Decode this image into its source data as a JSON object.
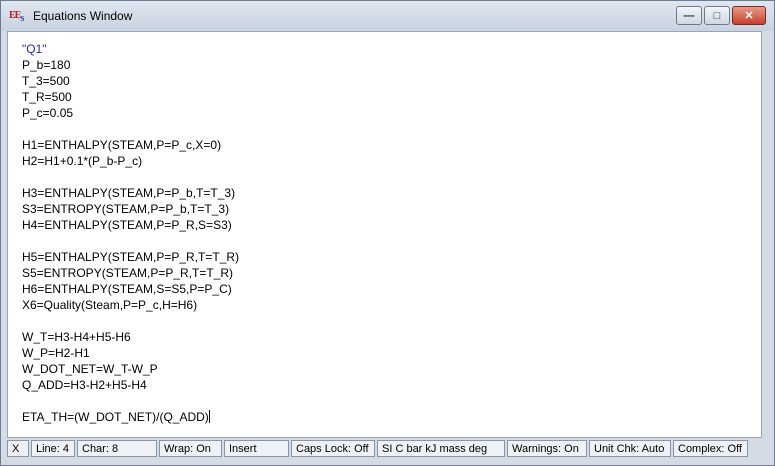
{
  "window": {
    "title": "Equations Window",
    "icon": "ees-app-icon",
    "icon_text": "EES"
  },
  "controls": {
    "minimize": "minimize-icon",
    "maximize": "maximize-icon",
    "close": "close-icon"
  },
  "editor": {
    "lines": [
      {
        "text": "\"Q1\"",
        "type": "comment"
      },
      {
        "text": "P_b=180",
        "type": "code"
      },
      {
        "text": "T_3=500",
        "type": "code"
      },
      {
        "text": "T_R=500",
        "type": "code"
      },
      {
        "text": "P_c=0.05",
        "type": "code"
      },
      {
        "text": "",
        "type": "blank"
      },
      {
        "text": "H1=ENTHALPY(STEAM,P=P_c,X=0)",
        "type": "code"
      },
      {
        "text": "H2=H1+0.1*(P_b-P_c)",
        "type": "code"
      },
      {
        "text": "",
        "type": "blank"
      },
      {
        "text": "H3=ENTHALPY(STEAM,P=P_b,T=T_3)",
        "type": "code"
      },
      {
        "text": "S3=ENTROPY(STEAM,P=P_b,T=T_3)",
        "type": "code"
      },
      {
        "text": "H4=ENTHALPY(STEAM,P=P_R,S=S3)",
        "type": "code"
      },
      {
        "text": "",
        "type": "blank"
      },
      {
        "text": "H5=ENTHALPY(STEAM,P=P_R,T=T_R)",
        "type": "code"
      },
      {
        "text": "S5=ENTROPY(STEAM,P=P_R,T=T_R)",
        "type": "code"
      },
      {
        "text": "H6=ENTHALPY(STEAM,S=S5,P=P_C)",
        "type": "code"
      },
      {
        "text": "X6=Quality(Steam,P=P_c,H=H6)",
        "type": "code"
      },
      {
        "text": "",
        "type": "blank"
      },
      {
        "text": "W_T=H3-H4+H5-H6",
        "type": "code"
      },
      {
        "text": "W_P=H2-H1",
        "type": "code"
      },
      {
        "text": "W_DOT_NET=W_T-W_P",
        "type": "code"
      },
      {
        "text": "Q_ADD=H3-H2+H5-H4",
        "type": "code"
      },
      {
        "text": "",
        "type": "blank"
      },
      {
        "text": "ETA_TH=(W_DOT_NET)/(Q_ADD)",
        "type": "code"
      }
    ]
  },
  "status": {
    "x": "X",
    "line": "Line: 4",
    "char": "Char: 8",
    "wrap": "Wrap: On",
    "mode": "Insert",
    "caps": "Caps Lock: Off",
    "units": "SI C bar kJ mass deg",
    "warnings": "Warnings: On",
    "unit_check": "Unit Chk: Auto",
    "complex": "Complex: Off"
  },
  "colors": {
    "comment": "#2a2ab0",
    "marker": "#e01818"
  }
}
